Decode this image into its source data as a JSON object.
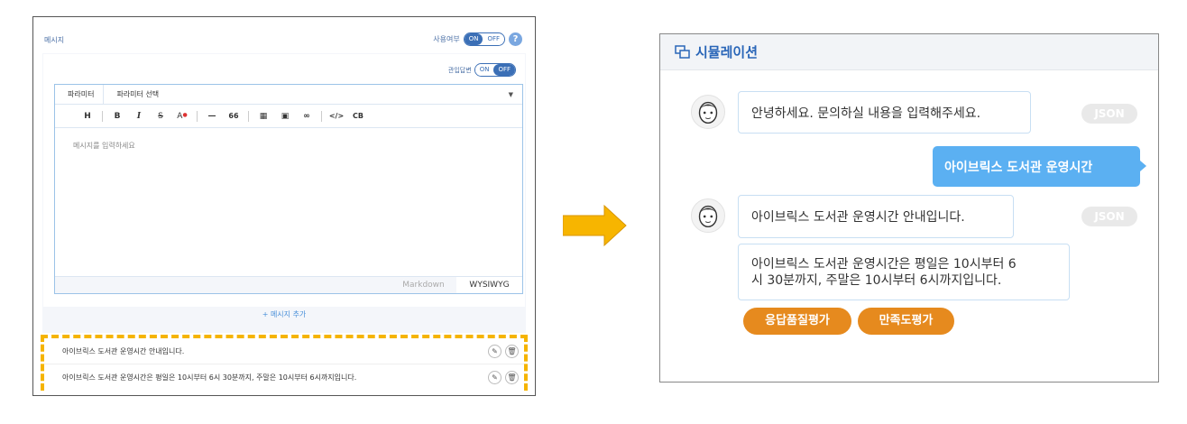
{
  "builder": {
    "section_label": "메시지",
    "use_label": "사용여부",
    "use_toggle": {
      "on": "ON",
      "off": "OFF"
    },
    "help_icon": "?",
    "fixed_answer_label": "관입답변",
    "fixed_toggle": {
      "on": "ON",
      "off": "OFF"
    },
    "param_tab": "파라미터",
    "param_select": "파라미터 선택",
    "toolbar": [
      "H",
      "B",
      "I",
      "S",
      "A",
      "—",
      "66",
      "▦",
      "▣",
      "∞",
      "</>",
      "CB"
    ],
    "editor_placeholder": "메시지를 입력하세요",
    "mode_tabs": [
      "Markdown",
      "WYSIWYG"
    ],
    "add_message": "+ 메시지 추가",
    "messages": [
      "아이브릭스 도서관 운영시간 안내입니다.",
      "아이브릭스 도서관 운영시간은 평일은 10시부터 6시 30분까지, 주말은 10시부터 6시까지입니다."
    ]
  },
  "simulation": {
    "title": "시뮬레이션",
    "bot_greeting": "안녕하세요. 문의하실 내용을 입력해주세요.",
    "json_badge": "JSON",
    "user_message": "아이브릭스 도서관 운영시간",
    "bot_reply_1": "아이브릭스 도서관 운영시간 안내입니다.",
    "bot_reply_2_line1": "아이브릭스 도서관 운영시간은 평일은 10시부터 6",
    "bot_reply_2_line2": "시 30분까지, 주말은 10시부터 6시까지입니다.",
    "quick_replies": [
      "응답품질평가",
      "만족도평가"
    ]
  },
  "colors": {
    "accent_blue": "#2a66b8",
    "user_bubble": "#5bb0f2",
    "quick_reply": "#e68a1e",
    "highlight": "#f5b400"
  }
}
